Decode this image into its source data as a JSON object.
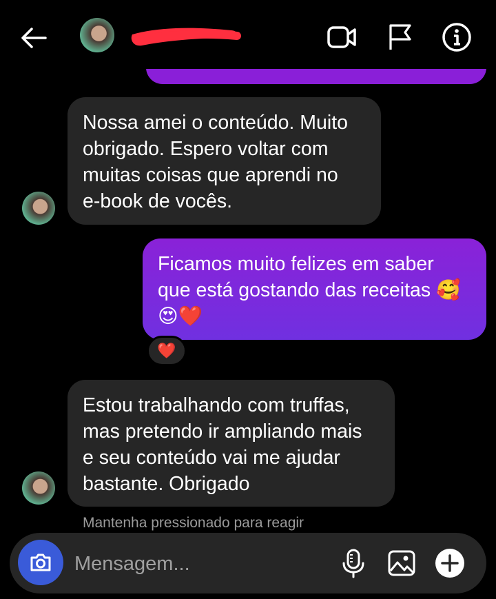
{
  "header": {
    "back_icon": "arrow-left-icon",
    "video_icon": "video-camera-icon",
    "report_icon": "flag-icon",
    "info_icon": "info-icon"
  },
  "messages": [
    {
      "side": "incoming",
      "text": "Nossa amei o conteúdo. Muito\nobrigado. Espero voltar com\nmuitas coisas que aprendi no\ne-book de vocês."
    },
    {
      "side": "outgoing",
      "text": "Ficamos muito felizes em saber\nque está gostando das receitas 🥰\n😍❤️"
    },
    {
      "side": "incoming",
      "text": "Estou trabalhando com truffas,\nmas pretendo ir ampliando mais\ne seu conteúdo vai me ajudar\nbastante. Obrigado"
    }
  ],
  "reaction": "❤️",
  "hint": "Mantenha pressionado para reagir",
  "composer": {
    "placeholder": "Mensagem...",
    "camera_icon": "camera-icon",
    "mic_icon": "microphone-icon",
    "gallery_icon": "image-icon",
    "add_icon": "plus-icon"
  },
  "colors": {
    "background": "#000000",
    "incoming_bubble": "#262626",
    "outgoing_bubble": "#8a22d8",
    "camera_button": "#3a5bd9"
  }
}
